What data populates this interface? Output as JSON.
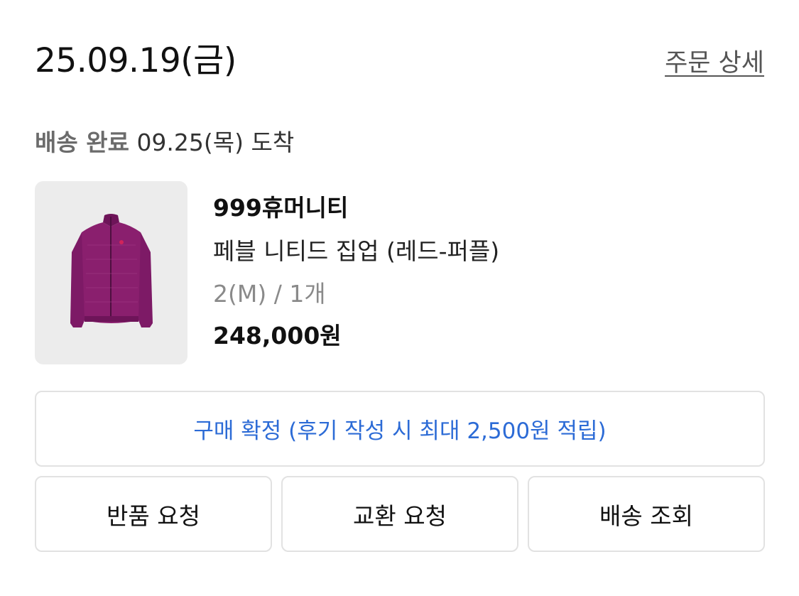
{
  "order": {
    "date": "25.09.19(금)",
    "detail_link": "주문 상세"
  },
  "delivery": {
    "status": "배송 완료",
    "arrival": "09.25(목) 도착"
  },
  "product": {
    "image_icon": "jacket-thumbnail",
    "brand": "999휴머니티",
    "name": "페블 니티드 집업 (레드-퍼플)",
    "option": "2(M) / 1개",
    "price": "248,000원"
  },
  "actions": {
    "confirm_label": "구매 확정 (후기 작성 시 최대 2,500원 적립)",
    "return_label": "반품 요청",
    "exchange_label": "교환 요청",
    "tracking_label": "배송 조회"
  },
  "colors": {
    "accent_blue": "#2c6bd6",
    "jacket_purple": "#8a1f6e",
    "thumb_bg": "#ececec",
    "button_border": "#e2e2e2"
  }
}
